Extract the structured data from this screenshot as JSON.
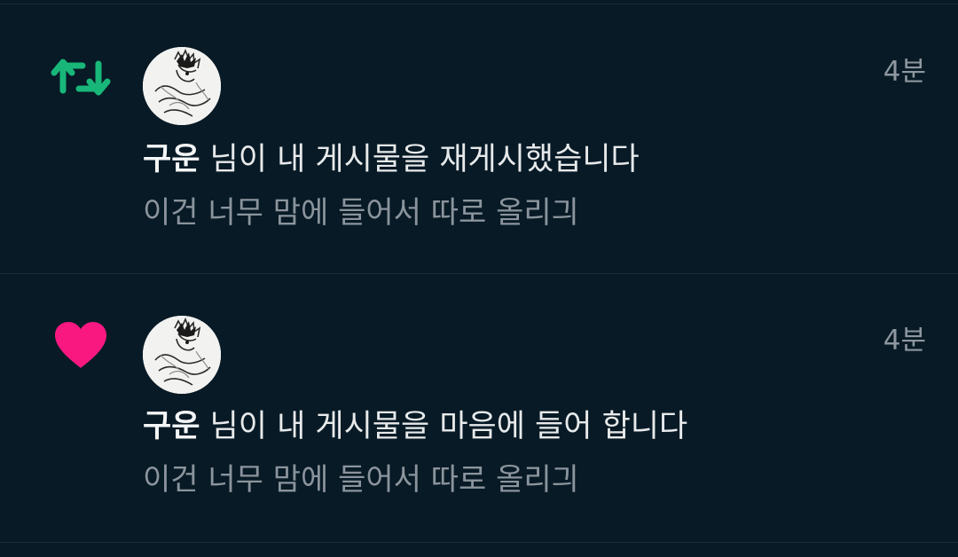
{
  "colors": {
    "background": "#071a26",
    "divider": "#1a2d3a",
    "retweet": "#19b67a",
    "like": "#f91880",
    "text_primary": "#e7e9ea",
    "text_secondary": "#8b949c"
  },
  "notifications": [
    {
      "type": "retweet",
      "icon": "retweet-icon",
      "time": "4분",
      "username": "구운",
      "action": "님이 내 게시물을 재게시했습니다",
      "post_text": "이건 너무 맘에 들어서 따로 올리긔"
    },
    {
      "type": "like",
      "icon": "heart-icon",
      "time": "4분",
      "username": "구운",
      "action": "님이 내 게시물을 마음에 들어 합니다",
      "post_text": "이건 너무 맘에 들어서 따로 올리긔"
    }
  ]
}
